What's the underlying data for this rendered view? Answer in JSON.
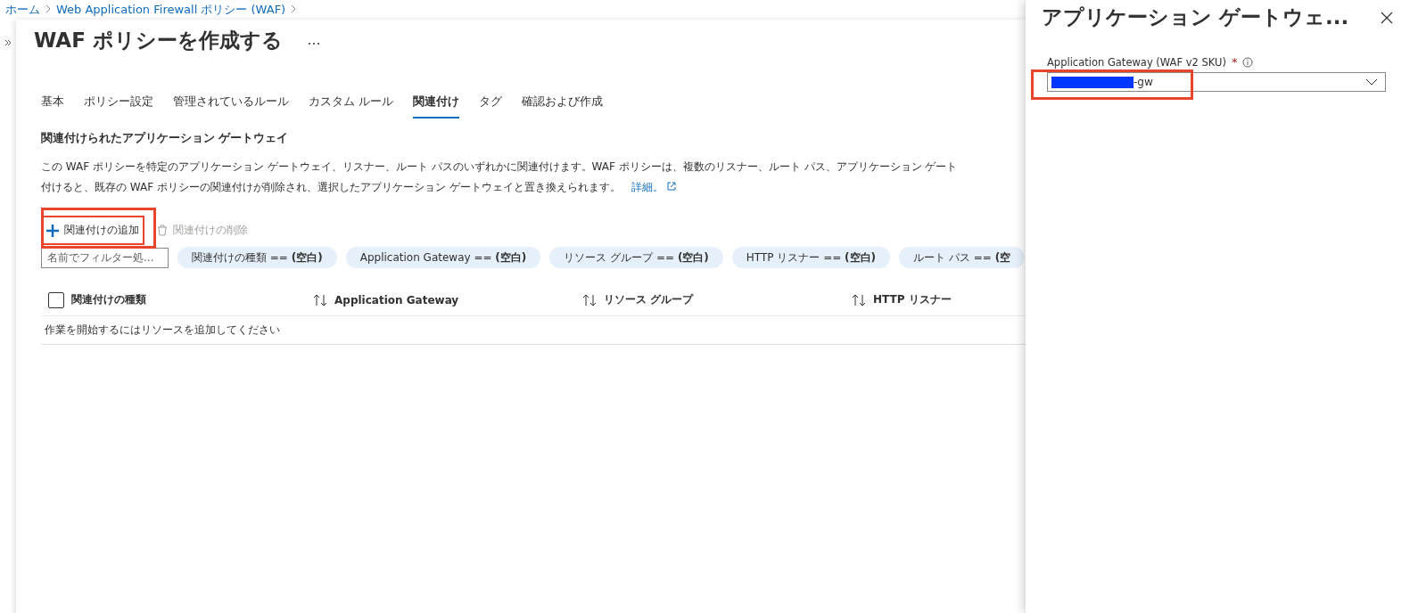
{
  "breadcrumb": [
    "ホーム",
    "Web Application Firewall ポリシー (WAF)"
  ],
  "page_title": "WAF ポリシーを作成する",
  "tabs": [
    {
      "label": "基本",
      "selected": false
    },
    {
      "label": "ポリシー設定",
      "selected": false
    },
    {
      "label": "管理されているルール",
      "selected": false
    },
    {
      "label": "カスタム ルール",
      "selected": false
    },
    {
      "label": "関連付け",
      "selected": true
    },
    {
      "label": "タグ",
      "selected": false
    },
    {
      "label": "確認および作成",
      "selected": false
    }
  ],
  "section_title": "関連付けられたアプリケーション ゲートウェイ",
  "description": [
    "この WAF ポリシーを特定のアプリケーション ゲートウェイ、リスナー、ルート パスのいずれかに関連付けます。WAF ポリシーは、複数のリスナー、ルート パス、アプリケーション ゲート",
    "付けると、既存の WAF ポリシーの関連付けが削除され、選択したアプリケーション ゲートウェイと置き換えられます。"
  ],
  "learn_more": "詳細。",
  "toolbar": [
    {
      "label": "関連付けの追加",
      "kind": "add",
      "disabled": false,
      "highlighted": true
    },
    {
      "label": "関連付けの削除",
      "kind": "delete",
      "disabled": true,
      "highlighted": false
    }
  ],
  "filter": {
    "placeholder": "名前でフィルター処..."
  },
  "filter_chips": [
    "関連付けの種類 == **(空白)**",
    "Application Gateway == **(空白)**",
    "リソース グループ == **(空白)**",
    "HTTP リスナー == **(空白)**",
    "ルート パス == **(空**"
  ],
  "table": {
    "select_all_checked": false,
    "columns": [
      "関連付けの種類",
      "Application Gateway",
      "リソース グループ",
      "HTTP リスナー"
    ],
    "empty_message": "作業を開始するにはリソースを追加してください"
  },
  "panel": {
    "title": "アプリケーション ゲートウェ...",
    "field": {
      "label": "Application Gateway (WAF v2 SKU)",
      "required_mark": "*",
      "value": "-gw",
      "redacted": true,
      "highlighted": true
    }
  }
}
